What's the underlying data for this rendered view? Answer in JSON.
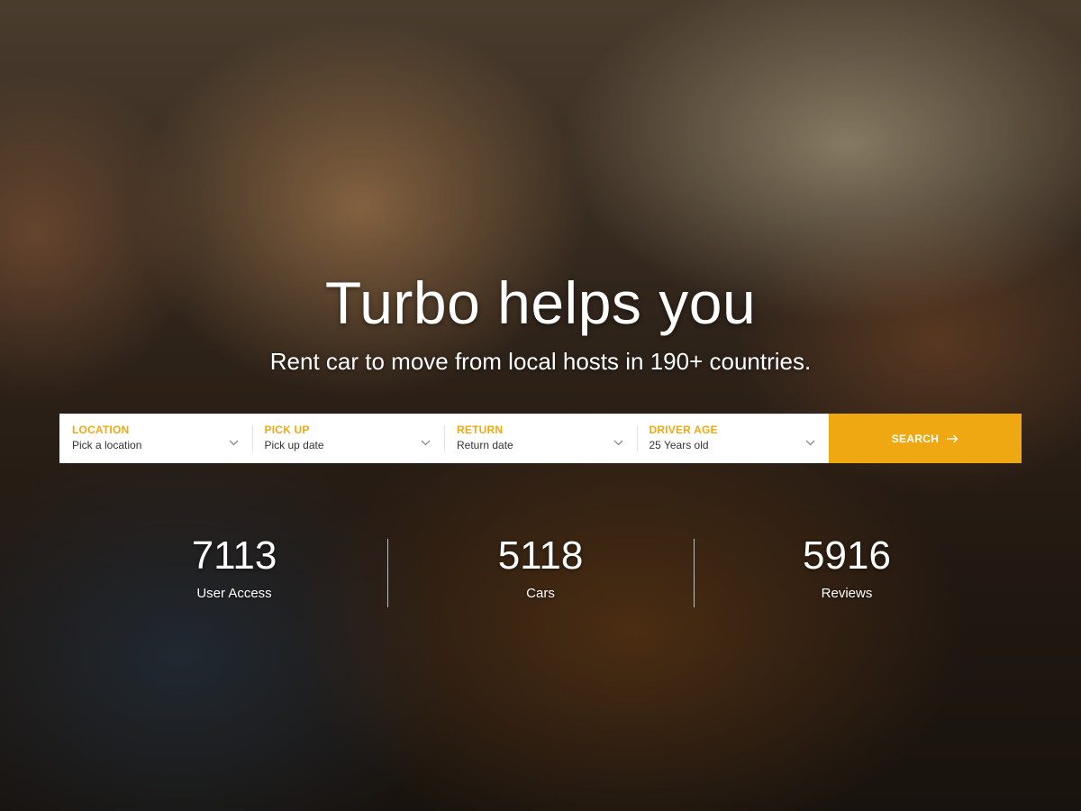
{
  "hero": {
    "title": "Turbo helps you",
    "subtitle": "Rent car to move from local hosts in 190+ countries."
  },
  "search": {
    "fields": [
      {
        "label": "LOCATION",
        "value": "Pick a location",
        "icon": "chevron-down-icon"
      },
      {
        "label": "PICK UP",
        "value": "Pick up date",
        "icon": "chevron-down-icon"
      },
      {
        "label": "RETURN",
        "value": "Return date",
        "icon": "chevron-down-icon"
      },
      {
        "label": "DRIVER AGE",
        "value": "25 Years old",
        "icon": "chevron-down-icon"
      }
    ],
    "button_label": "SEARCH",
    "button_icon": "arrow-right-icon"
  },
  "stats": [
    {
      "value": "7113",
      "label": "User Access"
    },
    {
      "value": "5118",
      "label": "Cars"
    },
    {
      "value": "5916",
      "label": "Reviews"
    }
  ],
  "colors": {
    "accent": "#f0a812",
    "field_value": "#333333",
    "bar_background": "#ffffff"
  }
}
